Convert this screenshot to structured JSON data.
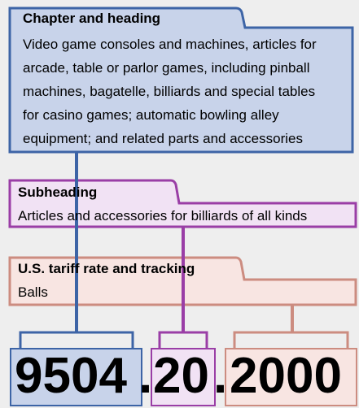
{
  "chapter": {
    "title": "Chapter and heading",
    "lines": [
      "Video game consoles and machines, articles for",
      "arcade, table or parlor games, including pinball",
      "machines, bagatelle, billiards and special tables",
      "for casino games; automatic bowling alley",
      "equipment; and related parts and accessories"
    ]
  },
  "subheading": {
    "title": "Subheading",
    "text": "Articles and accessories for billiards of all kinds"
  },
  "tariff": {
    "title": "U.S. tariff rate and tracking",
    "text": "Balls"
  },
  "code": {
    "chapter_part": "9504",
    "sep1": ".",
    "subheading_part": "20",
    "sep2": ".",
    "tariff_part": "2000"
  },
  "colors": {
    "chapter": "#c8d3ea",
    "chapter_border": "#3d64a6",
    "subheading": "#f1e2f4",
    "subheading_border": "#9a3ea6",
    "tariff": "#f8e5e2",
    "tariff_border": "#cc8c80"
  }
}
